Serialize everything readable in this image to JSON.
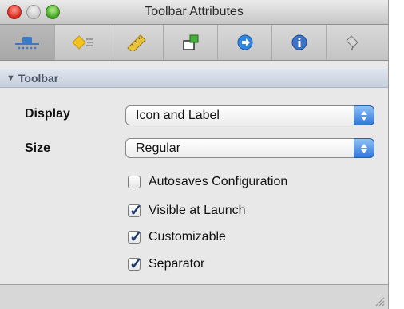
{
  "window": {
    "title": "Toolbar Attributes"
  },
  "tabs": [
    {
      "icon": "network-object-icon",
      "active": true
    },
    {
      "icon": "attributes-diamond-icon",
      "active": false
    },
    {
      "icon": "ruler-icon",
      "active": false
    },
    {
      "icon": "connections-icon",
      "active": false
    },
    {
      "icon": "bindings-arrow-icon",
      "active": false
    },
    {
      "icon": "info-icon",
      "active": false
    },
    {
      "icon": "applescript-icon",
      "active": false
    }
  ],
  "section": {
    "title": "Toolbar"
  },
  "display": {
    "label": "Display",
    "value": "Icon and Label"
  },
  "size": {
    "label": "Size",
    "value": "Regular"
  },
  "checkboxes": [
    {
      "label": "Autosaves Configuration",
      "checked": false
    },
    {
      "label": "Visible at Launch",
      "checked": true
    },
    {
      "label": "Customizable",
      "checked": true
    },
    {
      "label": "Separator",
      "checked": true
    }
  ],
  "colors": {
    "accent_popup": "#3a7fe0",
    "section_header": "#cfd6e2",
    "close": "#e0443a",
    "zoom": "#48b02a"
  }
}
